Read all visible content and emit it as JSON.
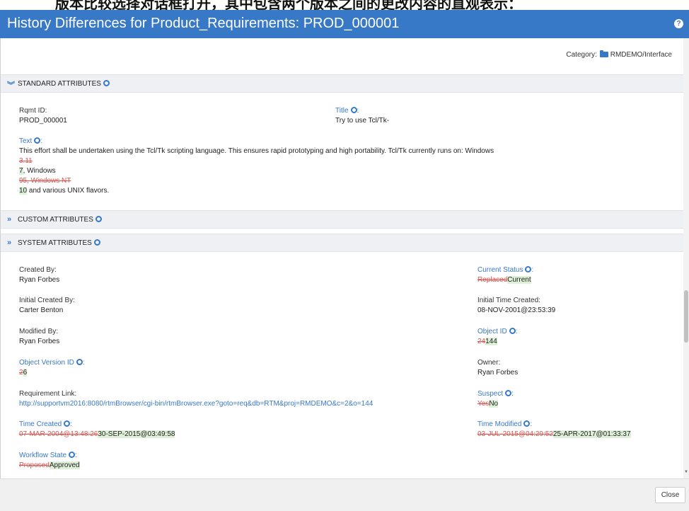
{
  "top_banner": "版本比较选择对话框打开，其中包含两个版本之间的更改内容的直观表示：",
  "dialog": {
    "title": "History Differences for Product_Requirements: PROD_000001",
    "category_label": "Category:",
    "category_value": "RMDEMO/Interface",
    "close_label": "Close"
  },
  "sections": {
    "standard": "STANDARD ATTRIBUTES",
    "custom": "CUSTOM ATTRIBUTES",
    "system": "SYSTEM ATTRIBUTES"
  },
  "standard": {
    "rqmt_id_label": "Rqmt ID:",
    "rqmt_id_value": "PROD_000001",
    "title_label": "Title",
    "title_value": "Try to use Tcl/Tk-",
    "text_label": "Text",
    "text_line1": "This effort shall be undertaken using the Tcl/Tk scripting language. This ensures rapid prototyping and high portability. Tcl/Tk currently runs on: Windows",
    "text_del1": "3.11",
    "text_ins1": "7",
    "text_line3_rest": ", Windows",
    "text_del2": "95, Windows NT",
    "text_ins2": "10",
    "text_line5_rest": " and various UNIX flavors."
  },
  "system": {
    "created_by_label": "Created By:",
    "created_by_value": "Ryan Forbes",
    "initial_created_by_label": "Initial Created By:",
    "initial_created_by_value": "Carter Benton",
    "modified_by_label": "Modified By:",
    "modified_by_value": "Ryan Forbes",
    "object_version_label": "Object Version ID",
    "object_version_del": "2",
    "object_version_ins": "6",
    "requirement_link_label": "Requirement Link:",
    "requirement_link_value": "http://supportvm2016:8080/rtmBrowser/cgi-bin/rtmBrowser.exe?goto=req&db=RTM&proj=RMDEMO&c=2&o=144",
    "time_created_label": "Time Created",
    "time_created_del": "07-MAR-2004@13:48:26",
    "time_created_ins": "30-SEP-2015@03:49:58",
    "workflow_state_label": "Workflow State",
    "workflow_state_del": "Proposed",
    "workflow_state_ins": "Approved",
    "current_status_label": "Current Status",
    "current_status_del": "Replaced",
    "current_status_ins": "Current",
    "initial_time_created_label": "Initial Time Created:",
    "initial_time_created_value": "08-NOV-2001@23:53:39",
    "object_id_label": "Object ID",
    "object_id_del": "24",
    "object_id_ins": "144",
    "owner_label": "Owner:",
    "owner_value": "Ryan Forbes",
    "suspect_label": "Suspect",
    "suspect_del": "Yes",
    "suspect_ins": "No",
    "time_modified_label": "Time Modified",
    "time_modified_del": "03-JUL-2015@04:29:52",
    "time_modified_ins": "25-APR-2017@01:33:37"
  },
  "colors": {
    "accent": "#3778c7",
    "deleted": "#d9534f",
    "inserted_bg": "#dff0d8"
  }
}
